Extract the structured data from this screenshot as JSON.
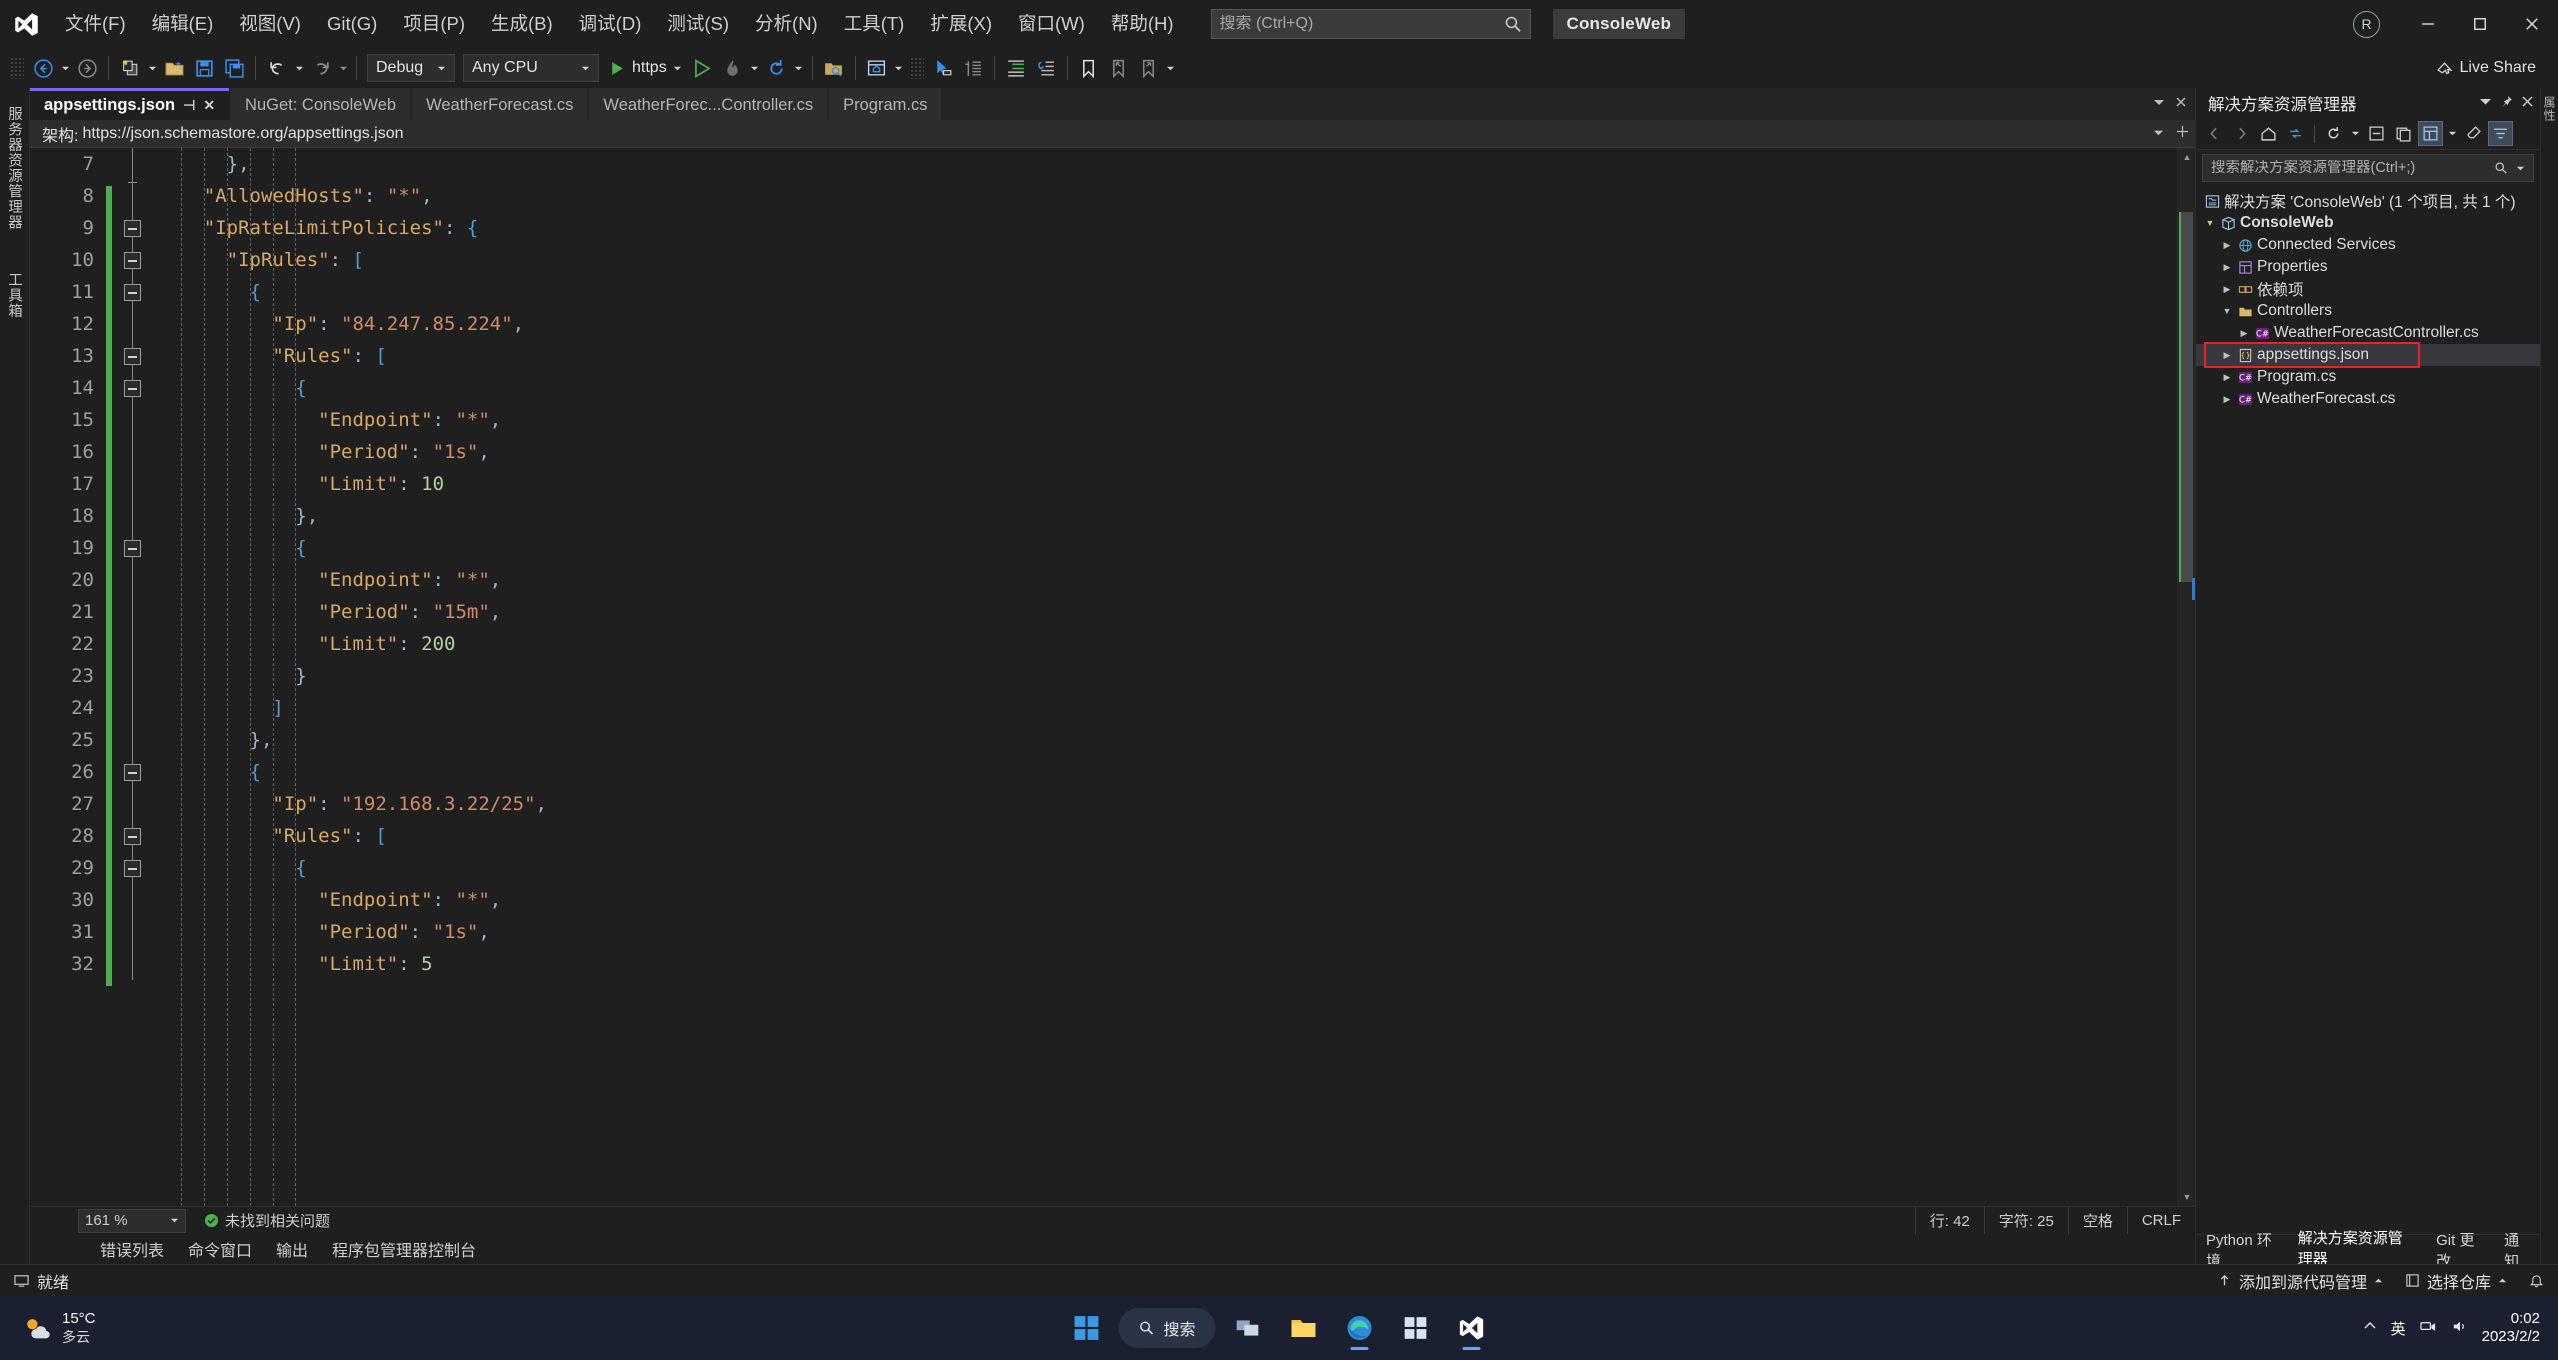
{
  "titlebar": {
    "menus": [
      {
        "label": "文件(F)",
        "name": "menu-file"
      },
      {
        "label": "编辑(E)",
        "name": "menu-edit"
      },
      {
        "label": "视图(V)",
        "name": "menu-view"
      },
      {
        "label": "Git(G)",
        "name": "menu-git"
      },
      {
        "label": "项目(P)",
        "name": "menu-project"
      },
      {
        "label": "生成(B)",
        "name": "menu-build"
      },
      {
        "label": "调试(D)",
        "name": "menu-debug"
      },
      {
        "label": "测试(S)",
        "name": "menu-test"
      },
      {
        "label": "分析(N)",
        "name": "menu-analyze"
      },
      {
        "label": "工具(T)",
        "name": "menu-tools"
      },
      {
        "label": "扩展(X)",
        "name": "menu-extensions"
      },
      {
        "label": "窗口(W)",
        "name": "menu-window"
      },
      {
        "label": "帮助(H)",
        "name": "menu-help"
      }
    ],
    "search_placeholder": "搜索 (Ctrl+Q)",
    "project_name": "ConsoleWeb",
    "account_initial": "R"
  },
  "toolbar": {
    "config": "Debug",
    "platform": "Any CPU",
    "run_label": "https",
    "live_share": "Live Share"
  },
  "editor_tabs": [
    {
      "label": "appsettings.json",
      "active": true
    },
    {
      "label": "NuGet: ConsoleWeb",
      "active": false
    },
    {
      "label": "WeatherForecast.cs",
      "active": false
    },
    {
      "label": "WeatherForec...Controller.cs",
      "active": false
    },
    {
      "label": "Program.cs",
      "active": false
    }
  ],
  "schema_bar": {
    "label": "架构:",
    "value": "https://json.schemastore.org/appsettings.json"
  },
  "code": {
    "first_line": 7,
    "lines": [
      {
        "n": 7,
        "fold": "none",
        "change": false,
        "tokens": [
          {
            "t": "      ",
            "c": "ind"
          },
          {
            "t": "},",
            "c": "p"
          }
        ]
      },
      {
        "n": 8,
        "fold": "none",
        "change": true,
        "tokens": [
          {
            "t": "    ",
            "c": "ind"
          },
          {
            "t": "\"AllowedHosts\"",
            "c": "k"
          },
          {
            "t": ": ",
            "c": "p"
          },
          {
            "t": "\"*\"",
            "c": "s"
          },
          {
            "t": ",",
            "c": "p"
          }
        ]
      },
      {
        "n": 9,
        "fold": "minus",
        "change": true,
        "tokens": [
          {
            "t": "    ",
            "c": "ind"
          },
          {
            "t": "\"IpRateLimitPolicies\"",
            "c": "k"
          },
          {
            "t": ": ",
            "c": "p"
          },
          {
            "t": "{",
            "c": "b"
          }
        ]
      },
      {
        "n": 10,
        "fold": "minus",
        "change": true,
        "tokens": [
          {
            "t": "      ",
            "c": "ind"
          },
          {
            "t": "\"IpRules\"",
            "c": "k"
          },
          {
            "t": ": ",
            "c": "p"
          },
          {
            "t": "[",
            "c": "b"
          }
        ]
      },
      {
        "n": 11,
        "fold": "minus",
        "change": true,
        "tokens": [
          {
            "t": "        ",
            "c": "ind"
          },
          {
            "t": "{",
            "c": "b"
          }
        ]
      },
      {
        "n": 12,
        "fold": "none",
        "change": true,
        "tokens": [
          {
            "t": "          ",
            "c": "ind"
          },
          {
            "t": "\"Ip\"",
            "c": "k"
          },
          {
            "t": ": ",
            "c": "p"
          },
          {
            "t": "\"84.247.85.224\"",
            "c": "s"
          },
          {
            "t": ",",
            "c": "p"
          }
        ]
      },
      {
        "n": 13,
        "fold": "minus",
        "change": true,
        "tokens": [
          {
            "t": "          ",
            "c": "ind"
          },
          {
            "t": "\"Rules\"",
            "c": "k"
          },
          {
            "t": ": ",
            "c": "p"
          },
          {
            "t": "[",
            "c": "b"
          }
        ]
      },
      {
        "n": 14,
        "fold": "minus",
        "change": true,
        "tokens": [
          {
            "t": "            ",
            "c": "ind"
          },
          {
            "t": "{",
            "c": "b"
          }
        ]
      },
      {
        "n": 15,
        "fold": "none",
        "change": true,
        "tokens": [
          {
            "t": "              ",
            "c": "ind"
          },
          {
            "t": "\"Endpoint\"",
            "c": "k"
          },
          {
            "t": ": ",
            "c": "p"
          },
          {
            "t": "\"*\"",
            "c": "s"
          },
          {
            "t": ",",
            "c": "p"
          }
        ]
      },
      {
        "n": 16,
        "fold": "none",
        "change": true,
        "tokens": [
          {
            "t": "              ",
            "c": "ind"
          },
          {
            "t": "\"Period\"",
            "c": "k"
          },
          {
            "t": ": ",
            "c": "p"
          },
          {
            "t": "\"1s\"",
            "c": "s"
          },
          {
            "t": ",",
            "c": "p"
          }
        ]
      },
      {
        "n": 17,
        "fold": "none",
        "change": true,
        "tokens": [
          {
            "t": "              ",
            "c": "ind"
          },
          {
            "t": "\"Limit\"",
            "c": "k"
          },
          {
            "t": ": ",
            "c": "p"
          },
          {
            "t": "10",
            "c": "n"
          }
        ]
      },
      {
        "n": 18,
        "fold": "none",
        "change": true,
        "tokens": [
          {
            "t": "            ",
            "c": "ind"
          },
          {
            "t": "},",
            "c": "p"
          }
        ]
      },
      {
        "n": 19,
        "fold": "minus",
        "change": true,
        "tokens": [
          {
            "t": "            ",
            "c": "ind"
          },
          {
            "t": "{",
            "c": "b"
          }
        ]
      },
      {
        "n": 20,
        "fold": "none",
        "change": true,
        "tokens": [
          {
            "t": "              ",
            "c": "ind"
          },
          {
            "t": "\"Endpoint\"",
            "c": "k"
          },
          {
            "t": ": ",
            "c": "p"
          },
          {
            "t": "\"*\"",
            "c": "s"
          },
          {
            "t": ",",
            "c": "p"
          }
        ]
      },
      {
        "n": 21,
        "fold": "none",
        "change": true,
        "tokens": [
          {
            "t": "              ",
            "c": "ind"
          },
          {
            "t": "\"Period\"",
            "c": "k"
          },
          {
            "t": ": ",
            "c": "p"
          },
          {
            "t": "\"15m\"",
            "c": "s"
          },
          {
            "t": ",",
            "c": "p"
          }
        ]
      },
      {
        "n": 22,
        "fold": "none",
        "change": true,
        "tokens": [
          {
            "t": "              ",
            "c": "ind"
          },
          {
            "t": "\"Limit\"",
            "c": "k"
          },
          {
            "t": ": ",
            "c": "p"
          },
          {
            "t": "200",
            "c": "n"
          }
        ]
      },
      {
        "n": 23,
        "fold": "none",
        "change": true,
        "tokens": [
          {
            "t": "            ",
            "c": "ind"
          },
          {
            "t": "}",
            "c": "p"
          }
        ]
      },
      {
        "n": 24,
        "fold": "none",
        "change": true,
        "tokens": [
          {
            "t": "          ",
            "c": "ind"
          },
          {
            "t": "]",
            "c": "b"
          }
        ]
      },
      {
        "n": 25,
        "fold": "none",
        "change": true,
        "tokens": [
          {
            "t": "        ",
            "c": "ind"
          },
          {
            "t": "},",
            "c": "p"
          }
        ]
      },
      {
        "n": 26,
        "fold": "minus",
        "change": true,
        "tokens": [
          {
            "t": "        ",
            "c": "ind"
          },
          {
            "t": "{",
            "c": "b"
          }
        ]
      },
      {
        "n": 27,
        "fold": "none",
        "change": true,
        "tokens": [
          {
            "t": "          ",
            "c": "ind"
          },
          {
            "t": "\"Ip\"",
            "c": "k"
          },
          {
            "t": ": ",
            "c": "p"
          },
          {
            "t": "\"192.168.3.22/25\"",
            "c": "s"
          },
          {
            "t": ",",
            "c": "p"
          }
        ]
      },
      {
        "n": 28,
        "fold": "minus",
        "change": true,
        "tokens": [
          {
            "t": "          ",
            "c": "ind"
          },
          {
            "t": "\"Rules\"",
            "c": "k"
          },
          {
            "t": ": ",
            "c": "p"
          },
          {
            "t": "[",
            "c": "b"
          }
        ]
      },
      {
        "n": 29,
        "fold": "minus",
        "change": true,
        "tokens": [
          {
            "t": "            ",
            "c": "ind"
          },
          {
            "t": "{",
            "c": "b"
          }
        ]
      },
      {
        "n": 30,
        "fold": "none",
        "change": true,
        "tokens": [
          {
            "t": "              ",
            "c": "ind"
          },
          {
            "t": "\"Endpoint\"",
            "c": "k"
          },
          {
            "t": ": ",
            "c": "p"
          },
          {
            "t": "\"*\"",
            "c": "s"
          },
          {
            "t": ",",
            "c": "p"
          }
        ]
      },
      {
        "n": 31,
        "fold": "none",
        "change": true,
        "tokens": [
          {
            "t": "              ",
            "c": "ind"
          },
          {
            "t": "\"Period\"",
            "c": "k"
          },
          {
            "t": ": ",
            "c": "p"
          },
          {
            "t": "\"1s\"",
            "c": "s"
          },
          {
            "t": ",",
            "c": "p"
          }
        ]
      },
      {
        "n": 32,
        "fold": "none",
        "change": true,
        "tokens": [
          {
            "t": "              ",
            "c": "ind"
          },
          {
            "t": "\"Limit\"",
            "c": "k"
          },
          {
            "t": ": ",
            "c": "p"
          },
          {
            "t": "5",
            "c": "n"
          }
        ]
      }
    ]
  },
  "editor_status": {
    "zoom": "161 %",
    "issues": "未找到相关问题",
    "line": "行: 42",
    "char": "字符: 25",
    "space": "空格",
    "eol": "CRLF"
  },
  "bottom_tabs": [
    "错误列表",
    "命令窗口",
    "输出",
    "程序包管理器控制台"
  ],
  "left_dock": [
    "服务器资源管理器",
    "工具箱"
  ],
  "right_dock": [
    "属性"
  ],
  "solution_explorer": {
    "title": "解决方案资源管理器",
    "search_placeholder": "搜索解决方案资源管理器(Ctrl+;)",
    "solution_label": "解决方案 'ConsoleWeb' (1 个项目, 共 1 个)",
    "tree": [
      {
        "label": "ConsoleWeb",
        "icon": "project-icon",
        "indent": 1,
        "chev": "down",
        "bold": true
      },
      {
        "label": "Connected Services",
        "icon": "connected-services-icon",
        "indent": 2,
        "chev": "right",
        "bold": false
      },
      {
        "label": "Properties",
        "icon": "properties-icon",
        "indent": 2,
        "chev": "right",
        "bold": false
      },
      {
        "label": "依赖项",
        "icon": "dependencies-icon",
        "indent": 2,
        "chev": "right",
        "bold": false
      },
      {
        "label": "Controllers",
        "icon": "folder-icon",
        "indent": 2,
        "chev": "down",
        "bold": false
      },
      {
        "label": "WeatherForecastController.cs",
        "icon": "csharp-icon",
        "indent": 3,
        "chev": "right",
        "bold": false
      },
      {
        "label": "appsettings.json",
        "icon": "json-icon",
        "indent": 2,
        "chev": "right",
        "bold": false,
        "selected": true,
        "highlighted": true
      },
      {
        "label": "Program.cs",
        "icon": "csharp-icon",
        "indent": 2,
        "chev": "right",
        "bold": false
      },
      {
        "label": "WeatherForecast.cs",
        "icon": "csharp-icon",
        "indent": 2,
        "chev": "right",
        "bold": false
      }
    ],
    "footer_tabs": [
      "Python 环境",
      "解决方案资源管理器",
      "Git 更改",
      "通知"
    ],
    "footer_active": "解决方案资源管理器",
    "highlight_color": "#f02020"
  },
  "ide_status": {
    "ready": "就绪",
    "add_source_control": "添加到源代码管理",
    "select_repo": "选择仓库"
  },
  "taskbar": {
    "weather_temp": "15°C",
    "weather_desc": "多云",
    "search_label": "搜索",
    "ime": "英",
    "time": "0:02",
    "date": "2023/2/2"
  }
}
